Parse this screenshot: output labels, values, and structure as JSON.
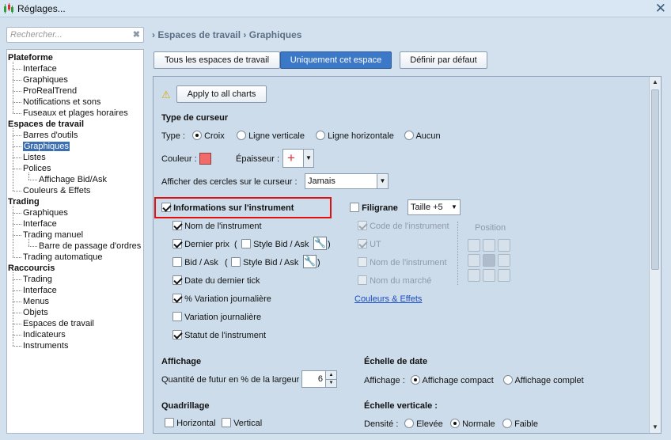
{
  "window": {
    "title": "Réglages...",
    "close_icon": "close-icon"
  },
  "search": {
    "placeholder": "Rechercher..."
  },
  "tree": {
    "nodes": [
      {
        "label": "Plateforme",
        "level": 0
      },
      {
        "label": "Interface",
        "level": 1
      },
      {
        "label": "Graphiques",
        "level": 1
      },
      {
        "label": "ProRealTrend",
        "level": 1
      },
      {
        "label": "Notifications et sons",
        "level": 1
      },
      {
        "label": "Fuseaux et plages horaires",
        "level": 1
      },
      {
        "label": "Espaces de travail",
        "level": 0
      },
      {
        "label": "Barres d'outils",
        "level": 1
      },
      {
        "label": "Graphiques",
        "level": 1,
        "selected": true
      },
      {
        "label": "Listes",
        "level": 1
      },
      {
        "label": "Polices",
        "level": 1
      },
      {
        "label": "Affichage Bid/Ask",
        "level": 2
      },
      {
        "label": "Couleurs & Effets",
        "level": 1
      },
      {
        "label": "Trading",
        "level": 0
      },
      {
        "label": "Graphiques",
        "level": 1
      },
      {
        "label": "Interface",
        "level": 1
      },
      {
        "label": "Trading manuel",
        "level": 1
      },
      {
        "label": "Barre de passage d'ordres",
        "level": 2
      },
      {
        "label": "Trading automatique",
        "level": 1
      },
      {
        "label": "Raccourcis",
        "level": 0
      },
      {
        "label": "Trading",
        "level": 1
      },
      {
        "label": "Interface",
        "level": 1
      },
      {
        "label": "Menus",
        "level": 1
      },
      {
        "label": "Objets",
        "level": 1
      },
      {
        "label": "Espaces de travail",
        "level": 1
      },
      {
        "label": "Indicateurs",
        "level": 1
      },
      {
        "label": "Instruments",
        "level": 1
      }
    ]
  },
  "breadcrumb": {
    "part1": "Espaces de travail",
    "part2": "Graphiques"
  },
  "scope_tabs": {
    "all": "Tous les espaces de travail",
    "only": "Uniquement cet espace",
    "default": "Définir par défaut"
  },
  "panel": {
    "apply_all": "Apply to all charts",
    "cursor": {
      "heading": "Type de curseur",
      "type_label": "Type :",
      "opt_croix": "Croix",
      "opt_vert": "Ligne verticale",
      "opt_horiz": "Ligne horizontale",
      "opt_none": "Aucun",
      "color_label": "Couleur :",
      "color": "#f26a6a",
      "thickness_label": "Épaisseur :",
      "circles_label": "Afficher des cercles sur le curseur :",
      "circles_value": "Jamais"
    },
    "info": {
      "heading": "Informations sur l'instrument",
      "name": "Nom de l'instrument",
      "last_price": "Dernier prix",
      "style_bid_ask": "Style Bid / Ask",
      "bid_ask": "Bid / Ask",
      "last_tick": "Date du dernier tick",
      "var_pct": "% Variation journalière",
      "var": "Variation journalière",
      "status": "Statut de l'instrument",
      "paren_open": "(",
      "paren_close": ")"
    },
    "watermark": {
      "heading": "Filigrane",
      "size": "Taille +5",
      "code": "Code de l'instrument",
      "ut": "UT",
      "name": "Nom de l'instrument",
      "market": "Nom du marché",
      "position": "Position",
      "link": "Couleurs & Effets"
    },
    "display": {
      "heading": "Affichage",
      "future_label": "Quantité de futur en % de la largeur",
      "future_value": "6"
    },
    "date_scale": {
      "heading": "Échelle de date",
      "label": "Affichage :",
      "compact": "Affichage compact",
      "full": "Affichage complet"
    },
    "grid": {
      "heading": "Quadrillage",
      "horizontal": "Horizontal",
      "vertical": "Vertical"
    },
    "vscale": {
      "heading": "Échelle verticale :",
      "label": "Densité :",
      "high": "Elevée",
      "normal": "Normale",
      "low": "Faible"
    }
  }
}
